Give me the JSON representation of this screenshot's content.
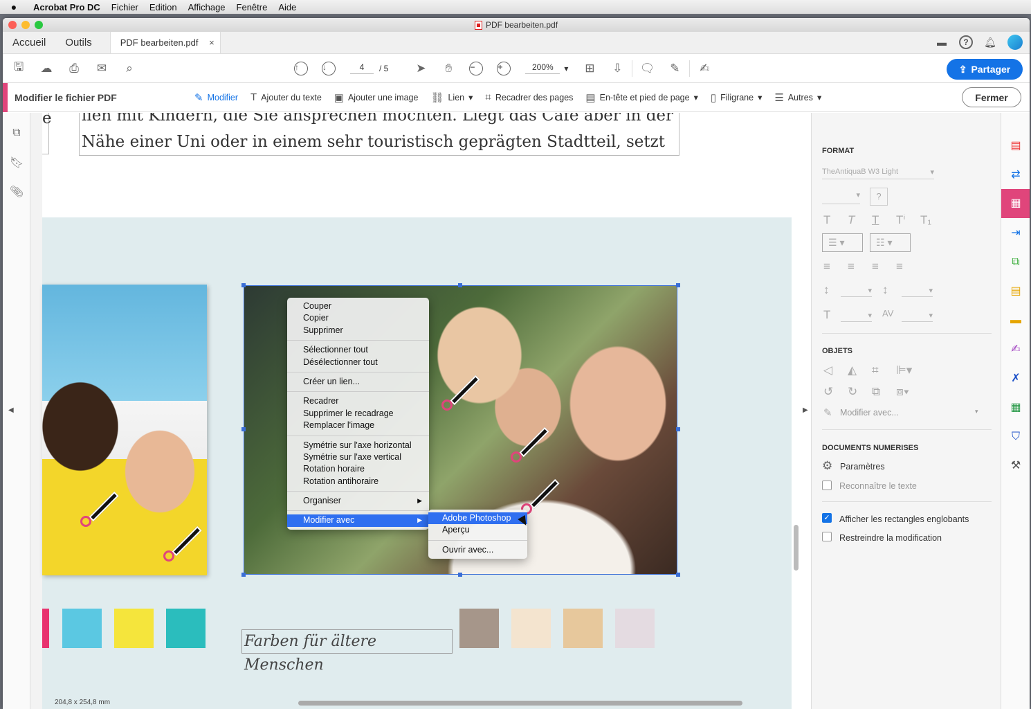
{
  "menubar": {
    "app": "Acrobat Pro DC",
    "items": [
      "Fichier",
      "Edition",
      "Affichage",
      "Fenêtre",
      "Aide"
    ]
  },
  "window": {
    "title": "PDF bearbeiten.pdf"
  },
  "tabs": {
    "home": "Accueil",
    "tools": "Outils",
    "doc": "PDF bearbeiten.pdf",
    "close": "×"
  },
  "toolbar": {
    "page_current": "4",
    "page_total": "/ 5",
    "zoom": "200%",
    "share": "Partager"
  },
  "editbar": {
    "title": "Modifier le fichier PDF",
    "tools": [
      "Modifier",
      "Ajouter du texte",
      "Ajouter une image",
      "Lien",
      "Recadrer des pages",
      "En-tête et pied de page",
      "Filigrane",
      "Autres"
    ],
    "close": "Fermer"
  },
  "document": {
    "line1": "lien mit Kindern, die Sie ansprechen möchten. Liegt das Café aber in der",
    "line2": "Nähe einer Uni oder in einem sehr touristisch geprägten Stadtteil, setzt",
    "frag": "e",
    "caption": "Farben für ältere Menschen",
    "dimensions": "204,8 x 254,8 mm",
    "swatches_left": [
      "#e8336f",
      "#5bc8e2",
      "#f5e53c",
      "#2bbdbd"
    ],
    "swatches_right": [
      "#a6968a",
      "#f4e4cf",
      "#e7c89c",
      "#e4dbe1"
    ]
  },
  "context_menu": {
    "items": [
      [
        "Couper",
        "Copier",
        "Supprimer"
      ],
      [
        "Sélectionner tout",
        "Désélectionner tout"
      ],
      [
        "Créer un lien..."
      ],
      [
        "Recadrer",
        "Supprimer le recadrage",
        "Remplacer l'image"
      ],
      [
        "Symétrie sur l'axe horizontal",
        "Symétrie sur l'axe vertical",
        "Rotation horaire",
        "Rotation antihoraire"
      ],
      [
        "Organiser",
        "Modifier avec"
      ]
    ],
    "submenu": [
      "Adobe Photoshop",
      "Aperçu",
      "Ouvrir avec..."
    ]
  },
  "panel": {
    "format_head": "FORMAT",
    "font": "TheAntiquaB W3 Light",
    "objects_head": "OBJETS",
    "edit_with": "Modifier avec...",
    "scanned_head": "DOCUMENTS NUMERISES",
    "settings": "Paramètres",
    "recognize": "Reconnaître le texte",
    "show_boxes": "Afficher les rectangles englobants",
    "restrict": "Restreindre la modification"
  },
  "colors": {
    "accent": "#e0457b",
    "primary": "#1473e6",
    "highlight": "#2f6ff0"
  }
}
